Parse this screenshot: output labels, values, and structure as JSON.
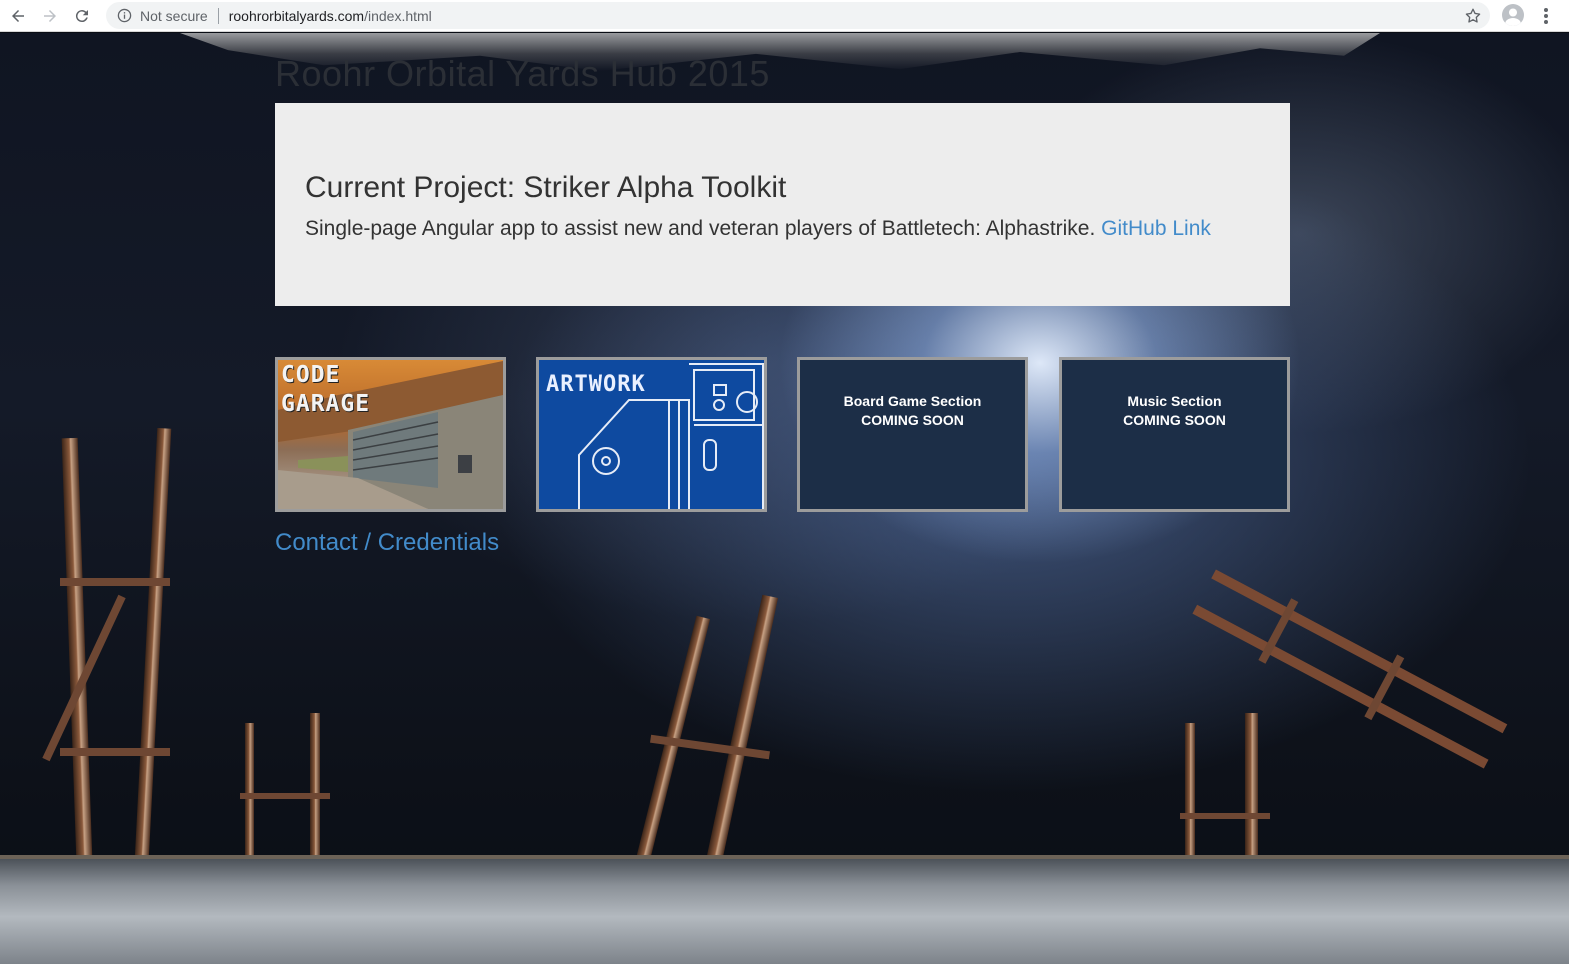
{
  "browser": {
    "security_label": "Not secure",
    "url_domain": "roohrorbitalyards.com",
    "url_path": "/index.html"
  },
  "page": {
    "site_title": "Roohr Orbital Yards Hub 2015",
    "jumbotron": {
      "heading": "Current Project: Striker Alpha Toolkit",
      "description": "Single-page Angular app to assist new and veteran players of Battletech: Alphastrike.",
      "link_label": "GitHub Link"
    },
    "tiles": [
      {
        "label_line1": "CODE",
        "label_line2": "GARAGE"
      },
      {
        "label": "ARTWORK"
      },
      {
        "title": "Board Game Section",
        "status": "COMING SOON"
      },
      {
        "title": "Music Section",
        "status": "COMING SOON"
      }
    ],
    "contact_link": "Contact / Credentials"
  },
  "colors": {
    "link": "#428bca",
    "jumbotron_bg": "#ededed",
    "tile_bg": "#1c2e47",
    "artwork_bg": "#0e4aa0"
  }
}
